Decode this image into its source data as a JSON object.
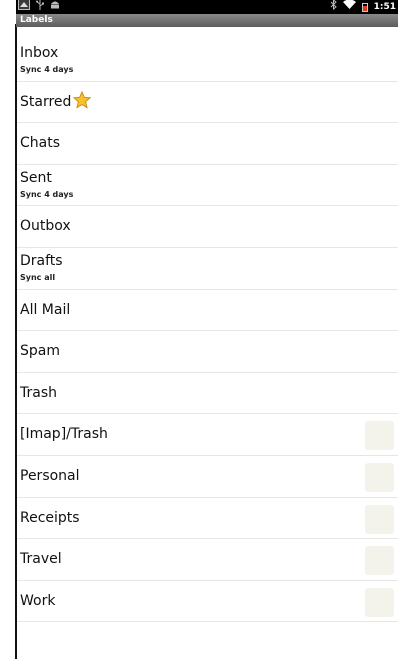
{
  "statusbar": {
    "left_icons": [
      "notification-icon",
      "usb-icon",
      "android-debug-icon"
    ],
    "right_icons": [
      "bluetooth-icon",
      "wifi-icon",
      "battery-icon"
    ],
    "battery_color": "#e03a1e",
    "time": "1:51"
  },
  "header": {
    "title": "Labels"
  },
  "labels": [
    {
      "name": "Inbox",
      "sub": "Sync 4 days"
    },
    {
      "name": "Starred",
      "icon": "star-icon"
    },
    {
      "name": "Chats"
    },
    {
      "name": "Sent",
      "sub": "Sync 4 days"
    },
    {
      "name": "Outbox"
    },
    {
      "name": "Drafts",
      "sub": "Sync all"
    },
    {
      "name": "All Mail"
    },
    {
      "name": "Spam"
    },
    {
      "name": "Trash"
    },
    {
      "name": "[Imap]/Trash",
      "color_swatch": "#f3f3ec"
    },
    {
      "name": "Personal",
      "color_swatch": "#f3f3ec"
    },
    {
      "name": "Receipts",
      "color_swatch": "#f3f3ec"
    },
    {
      "name": "Travel",
      "color_swatch": "#f3f3ec"
    },
    {
      "name": "Work",
      "color_swatch": "#f3f3ec"
    }
  ]
}
